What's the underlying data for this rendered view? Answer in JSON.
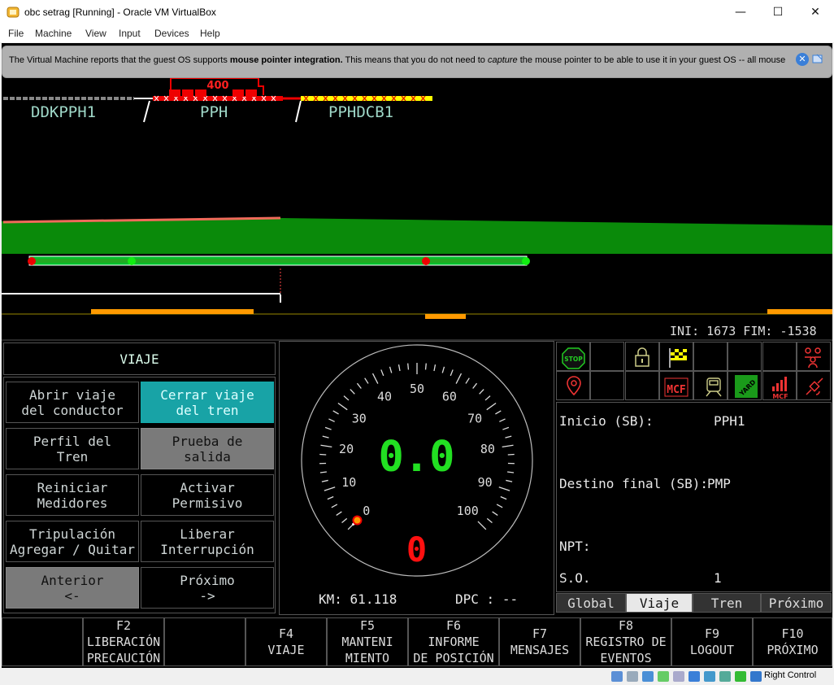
{
  "window": {
    "title": "obc setrag [Running] - Oracle VM VirtualBox",
    "controls": {
      "minimize": "—",
      "maximize": "☐",
      "close": "✕"
    }
  },
  "menubar": [
    "File",
    "Machine",
    "View",
    "Input",
    "Devices",
    "Help"
  ],
  "notice": {
    "before": "The Virtual Machine reports that the guest OS supports ",
    "bold": "mouse pointer integration.",
    "middle": " This means that you do not need to ",
    "italic": "capture",
    "after": " the mouse pointer to be able to use it in your guest OS -- all mouse"
  },
  "track": {
    "train_number": "400",
    "labels": [
      "DDKPPH1",
      "PPH",
      "PPHDCB1"
    ],
    "range_text": "INI: 1673 FIM: -1538"
  },
  "viaje_panel": {
    "title": "VIAJE",
    "buttons": [
      {
        "label": "Abrir viaje\ndel conductor",
        "style": "normal"
      },
      {
        "label": "Cerrar viaje\ndel tren",
        "style": "teal"
      },
      {
        "label": "Perfil del\nTren",
        "style": "normal"
      },
      {
        "label": "Prueba de\nsalida",
        "style": "gray"
      },
      {
        "label": "Reiniciar\nMedidores",
        "style": "normal"
      },
      {
        "label": "Activar\nPermisivo",
        "style": "normal"
      },
      {
        "label": "Tripulación\nAgregar / Quitar",
        "style": "normal"
      },
      {
        "label": "Liberar\nInterrupción",
        "style": "normal"
      },
      {
        "label": "Anterior\n<-",
        "style": "gray"
      },
      {
        "label": "Próximo\n->",
        "style": "normal"
      }
    ]
  },
  "speedometer": {
    "speed": "0.0",
    "limit": "0",
    "ticks": [
      "0",
      "10",
      "20",
      "30",
      "40",
      "50",
      "60",
      "70",
      "80",
      "90",
      "100"
    ],
    "needle_value": 0,
    "km_label": "KM:",
    "km_value": "61.118",
    "dpc_label": "DPC :",
    "dpc_value": "--"
  },
  "status_icons": {
    "row1": [
      "stop-icon",
      "",
      "padlock-icon",
      "checkered-flag-icon",
      "",
      "",
      "",
      "group-icon"
    ],
    "row2": [
      "location-pin-icon",
      "",
      "",
      "mcf-icon",
      "locomotive-icon",
      "yard-icon",
      "signal-mcf-icon",
      "satellite-icon"
    ],
    "stop_text": "STOP",
    "mcf_text": "MCF",
    "yard_text": "YARD",
    "mcf_small_text": "MCF"
  },
  "trip_info": {
    "inicio_label": "Inicio (SB):",
    "inicio_value": "PPH1",
    "destino_label": "Destino final (SB):",
    "destino_value": "PMP",
    "npt_label": "NPT:",
    "npt_value": "",
    "so_label": "S.O.",
    "so_value": "1"
  },
  "tabs": [
    {
      "label": "Global",
      "active": false
    },
    {
      "label": "Viaje",
      "active": true
    },
    {
      "label": "Tren",
      "active": false
    },
    {
      "label": "Próximo",
      "active": false
    }
  ],
  "fkeys": [
    {
      "label": ""
    },
    {
      "label": "F2\nLIBERACIÓN\nPRECAUCIÓN"
    },
    {
      "label": ""
    },
    {
      "label": "F4\nVIAJE"
    },
    {
      "label": "F5\nMANTENI\nMIENTO"
    },
    {
      "label": "F6\nINFORME\nDE POSICIÓN"
    },
    {
      "label": "F7\nMENSAJES"
    },
    {
      "label": "F8\nREGISTRO DE\nEVENTOS"
    },
    {
      "label": "F9\nLOGOUT"
    },
    {
      "label": "F10\nPRÓXIMO"
    }
  ],
  "statusbar": {
    "host_key": "Right Control"
  },
  "colors": {
    "green_terrain": "#0a8a0a",
    "speed_green": "#22e022",
    "limit_red": "#ff1010",
    "teal": "#18a3a6",
    "orange": "#ff9a00"
  }
}
